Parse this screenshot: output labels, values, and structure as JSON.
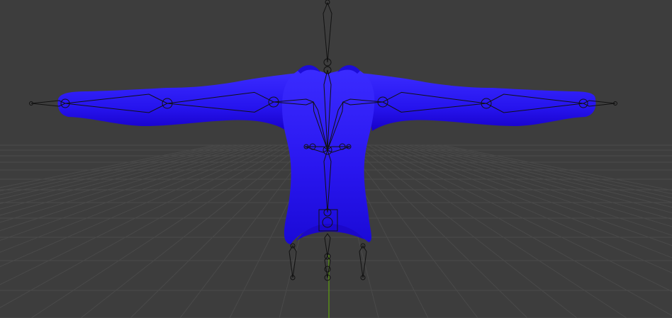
{
  "viewport": {
    "background_color": "#3d3d3d",
    "grid_line_color": "#4a4a4a",
    "grid_axis_color": "#5fa10f",
    "mesh_color": "#2a17f0",
    "mesh_highlight_color": "#3b2cff",
    "mesh_shadow_color": "#1600c8",
    "armature_line_color": "#111111"
  }
}
